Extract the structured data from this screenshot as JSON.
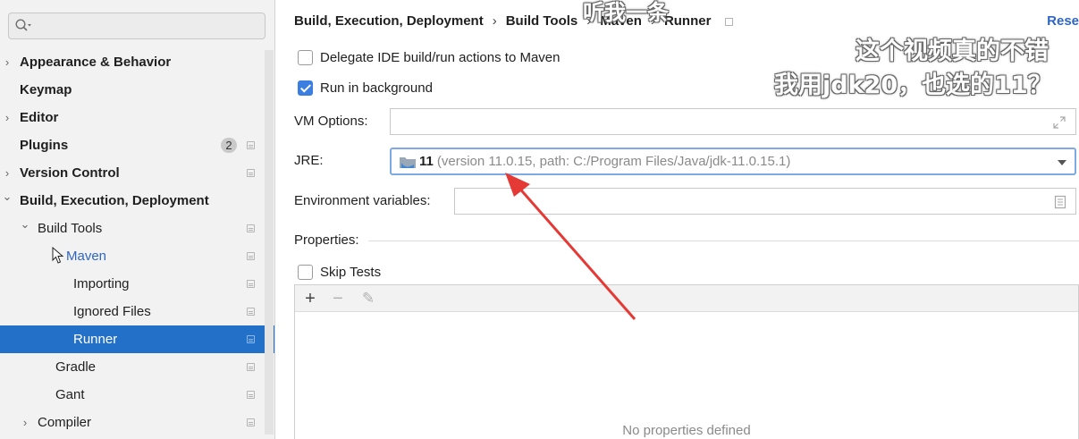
{
  "search": {
    "value": "",
    "placeholder": ""
  },
  "sidebar": {
    "items": [
      {
        "label": "Appearance & Behavior",
        "bold": true,
        "chevron": "›",
        "indent": 0
      },
      {
        "label": "Keymap",
        "bold": true,
        "chevron": "",
        "indent": 0
      },
      {
        "label": "Editor",
        "bold": true,
        "chevron": "›",
        "indent": 0
      },
      {
        "label": "Plugins",
        "bold": true,
        "chevron": "",
        "indent": 0,
        "badge": "2",
        "page_icon": true
      },
      {
        "label": "Version Control",
        "bold": true,
        "chevron": "›",
        "indent": 0,
        "page_icon": true
      },
      {
        "label": "Build, Execution, Deployment",
        "bold": true,
        "chevron": "⌄",
        "indent": 0
      },
      {
        "label": "Build Tools",
        "bold": false,
        "chevron": "⌄",
        "indent": 1,
        "page_icon": true
      },
      {
        "label": "Maven",
        "bold": false,
        "chevron": "",
        "indent": 2,
        "link": true,
        "page_icon": true,
        "cursor": true
      },
      {
        "label": "Importing",
        "bold": false,
        "chevron": "",
        "indent": 3,
        "page_icon": true
      },
      {
        "label": "Ignored Files",
        "bold": false,
        "chevron": "",
        "indent": 3,
        "page_icon": true
      },
      {
        "label": "Runner",
        "bold": false,
        "chevron": "",
        "indent": 3,
        "page_icon": true,
        "selected": true
      },
      {
        "label": "Gradle",
        "bold": false,
        "chevron": "",
        "indent": 2,
        "page_icon": true
      },
      {
        "label": "Gant",
        "bold": false,
        "chevron": "",
        "indent": 2,
        "page_icon": true
      },
      {
        "label": "Compiler",
        "bold": false,
        "chevron": "›",
        "indent": 1,
        "page_icon": true
      }
    ]
  },
  "breadcrumb": {
    "items": [
      "Build, Execution, Deployment",
      "Build Tools",
      "Maven",
      "Runner"
    ],
    "separator": "›"
  },
  "reset_label": "Rese",
  "options": {
    "delegate": {
      "label": "Delegate IDE build/run actions to Maven",
      "checked": false
    },
    "background": {
      "label": "Run in background",
      "checked": true
    },
    "skip_tests": {
      "label": "Skip Tests",
      "checked": false
    }
  },
  "vm_options": {
    "label": "VM Options:",
    "value": ""
  },
  "jre": {
    "label": "JRE:",
    "value": "11",
    "detail": "(version 11.0.15, path: C:/Program Files/Java/jdk-11.0.15.1)"
  },
  "env": {
    "label": "Environment variables:",
    "value": ""
  },
  "properties": {
    "label": "Properties:",
    "toolbar": {
      "add": "+",
      "remove": "−",
      "edit": "✎"
    },
    "empty_text": "No properties defined"
  },
  "overlays": {
    "top": "听我一条",
    "line1": "这个视频真的不错",
    "line2": "我用jdk20，也选的11？"
  },
  "colors": {
    "selection": "#2370c9",
    "link": "#2f66c4",
    "checkbox_checked": "#3b7de0",
    "arrow": "#e53935"
  }
}
